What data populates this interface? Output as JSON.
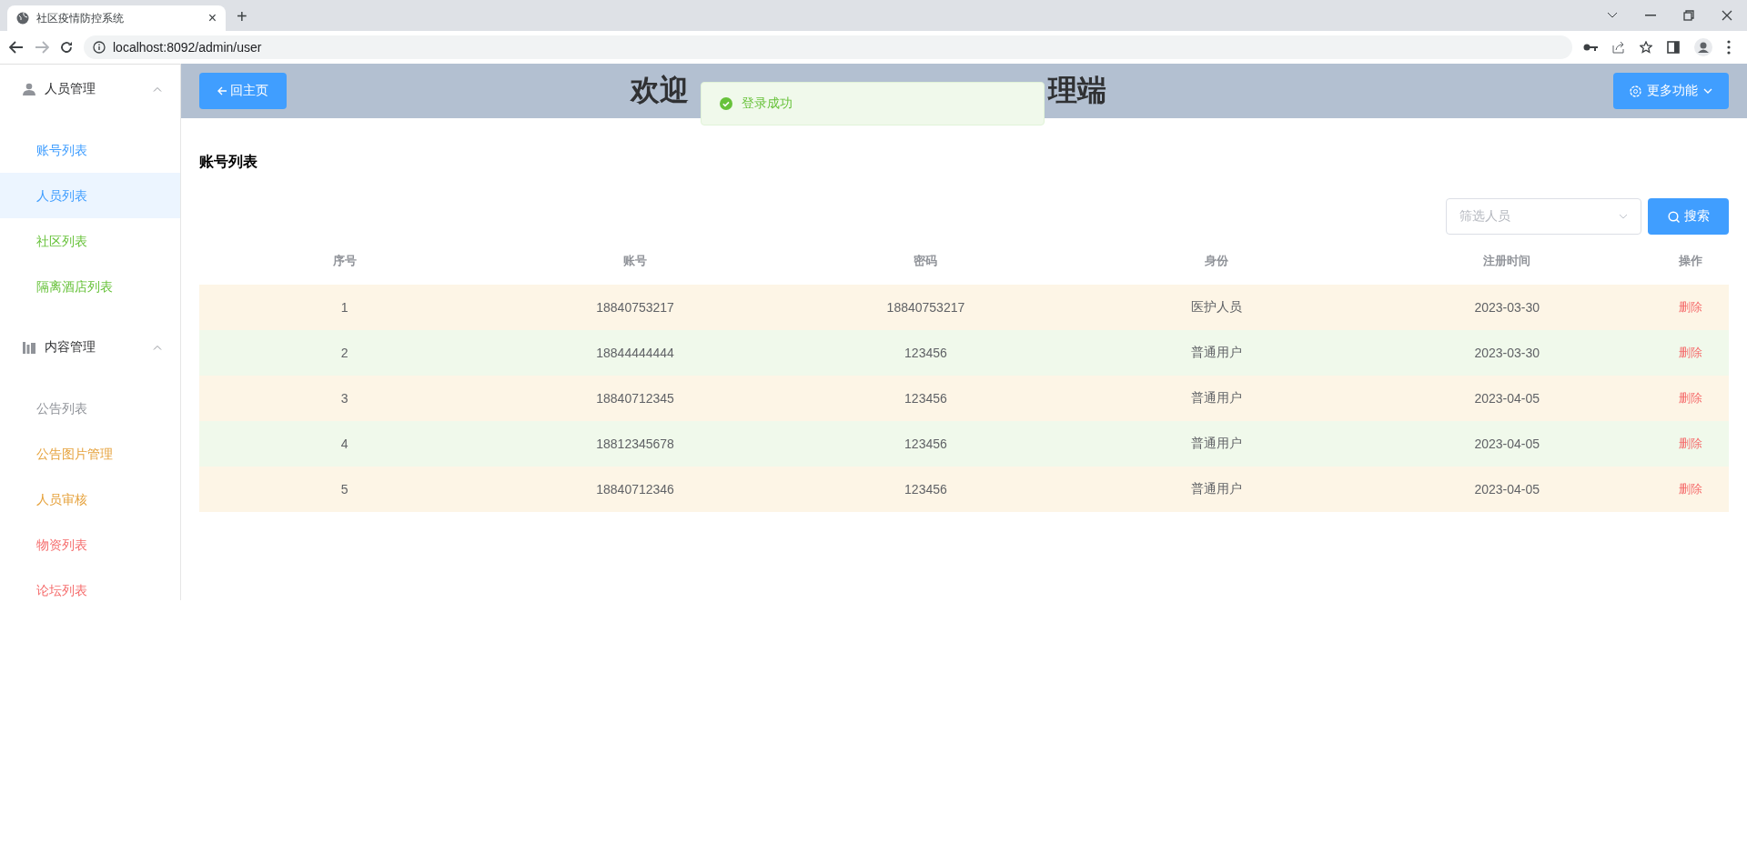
{
  "browser": {
    "tab_title": "社区疫情防控系统",
    "tab_close": "×",
    "new_tab": "+",
    "url": "localhost:8092/admin/user",
    "forward_disabled": true
  },
  "sidebar": {
    "groups": [
      {
        "kind": "people",
        "label": "人员管理",
        "expanded": true,
        "items": [
          {
            "label": "账号列表",
            "color": "#409eff",
            "selected": false
          },
          {
            "label": "人员列表",
            "color": "#409eff",
            "selected": true
          },
          {
            "label": "社区列表",
            "color": "#67c23a",
            "selected": false
          },
          {
            "label": "隔离酒店列表",
            "color": "#67c23a",
            "selected": false
          }
        ]
      },
      {
        "kind": "content",
        "label": "内容管理",
        "expanded": true,
        "items": [
          {
            "label": "公告列表",
            "color": "#909399",
            "selected": false
          },
          {
            "label": "公告图片管理",
            "color": "#e6a23c",
            "selected": false
          },
          {
            "label": "人员审核",
            "color": "#e6a23c",
            "selected": false
          },
          {
            "label": "物资列表",
            "color": "#f56c6c",
            "selected": false
          },
          {
            "label": "论坛列表",
            "color": "#f56c6c",
            "selected": false
          }
        ]
      }
    ]
  },
  "header": {
    "back_button": "回主页",
    "title_start": "欢迎",
    "title_end": "理端",
    "more_button": "更多功能"
  },
  "toast": {
    "message": "登录成功"
  },
  "page_title": "账号列表",
  "filter": {
    "placeholder": "筛选人员"
  },
  "search_button": "搜索",
  "table": {
    "columns": [
      "序号",
      "账号",
      "密码",
      "身份",
      "注册时间",
      "操作"
    ],
    "rows": [
      {
        "color": "#fdf5e6",
        "cells": [
          "1",
          "18840753217",
          "18840753217",
          "医护人员",
          "2023-03-30"
        ],
        "action": "删除"
      },
      {
        "color": "#f0f9eb",
        "cells": [
          "2",
          "18844444444",
          "123456",
          "普通用户",
          "2023-03-30"
        ],
        "action": "删除"
      },
      {
        "color": "#fdf5e6",
        "cells": [
          "3",
          "18840712345",
          "123456",
          "普通用户",
          "2023-04-05"
        ],
        "action": "删除"
      },
      {
        "color": "#f0f9eb",
        "cells": [
          "4",
          "18812345678",
          "123456",
          "普通用户",
          "2023-04-05"
        ],
        "action": "删除"
      },
      {
        "color": "#fdf5e6",
        "cells": [
          "5",
          "18840712346",
          "123456",
          "普通用户",
          "2023-04-05"
        ],
        "action": "删除"
      }
    ]
  }
}
